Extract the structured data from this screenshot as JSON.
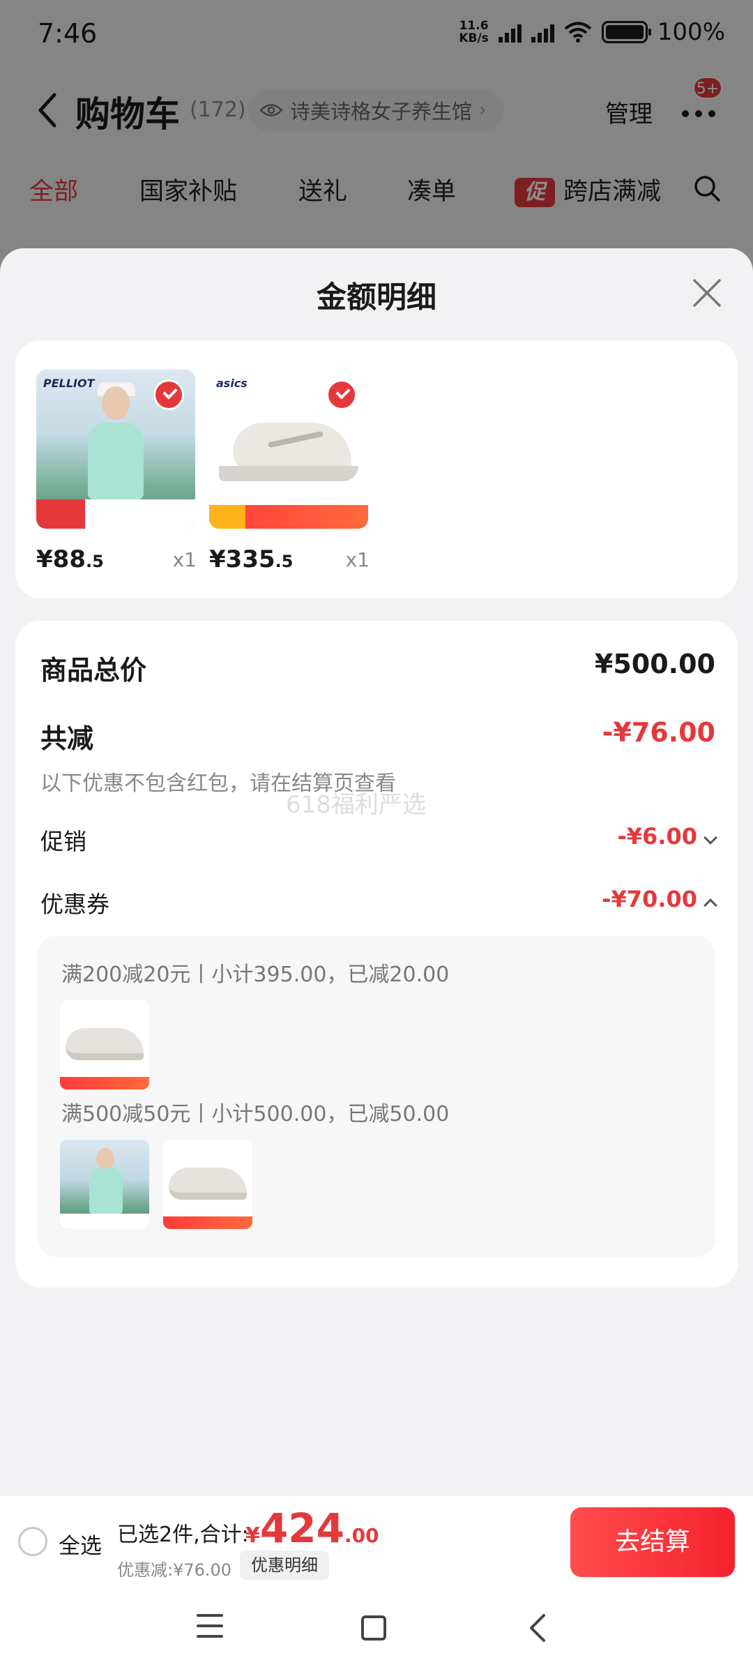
{
  "status_bar": {
    "time": "7:46",
    "net_speed_value": "11.6",
    "net_speed_unit": "KB/s",
    "battery": "100%"
  },
  "cart_header": {
    "title": "购物车",
    "count": "(172)",
    "shop_name": "诗美诗格女子养生馆",
    "manage": "管理",
    "badge": "5+"
  },
  "filter_tabs": [
    "全部",
    "国家补贴",
    "送礼",
    "凑单",
    "跨店满减"
  ],
  "promo_tag": "促",
  "sheet": {
    "title": "金额明细",
    "items": [
      {
        "price_int": "¥88",
        "price_dec": ".5",
        "qty": "x1",
        "brand": "PELLIOT"
      },
      {
        "price_int": "¥335",
        "price_dec": ".5",
        "qty": "x1",
        "brand": "asics"
      }
    ],
    "summary": {
      "total_label": "商品总价",
      "total_value": "¥500.00",
      "reduce_label": "共减",
      "reduce_value": "-¥76.00",
      "note": "以下优惠不包含红包，请在结算页查看",
      "watermark": "618福利严选",
      "promo_label": "促销",
      "promo_value": "-¥6.00",
      "coupon_label": "优惠券",
      "coupon_value": "-¥70.00",
      "coupon_rules": [
        "满200减20元丨小计395.00，已减20.00",
        "满500减50元丨小计500.00，已减50.00"
      ]
    }
  },
  "checkout_bar": {
    "select_all": "全选",
    "selected": "已选2件,合计:",
    "currency": "¥",
    "total_int": "424",
    "total_dec": ".00",
    "discount": "优惠减:¥76.00",
    "detail": "优惠明细",
    "checkout": "去结算"
  },
  "colors": {
    "accent_red": "#e4393c",
    "checkout_red": "#f5222d"
  }
}
